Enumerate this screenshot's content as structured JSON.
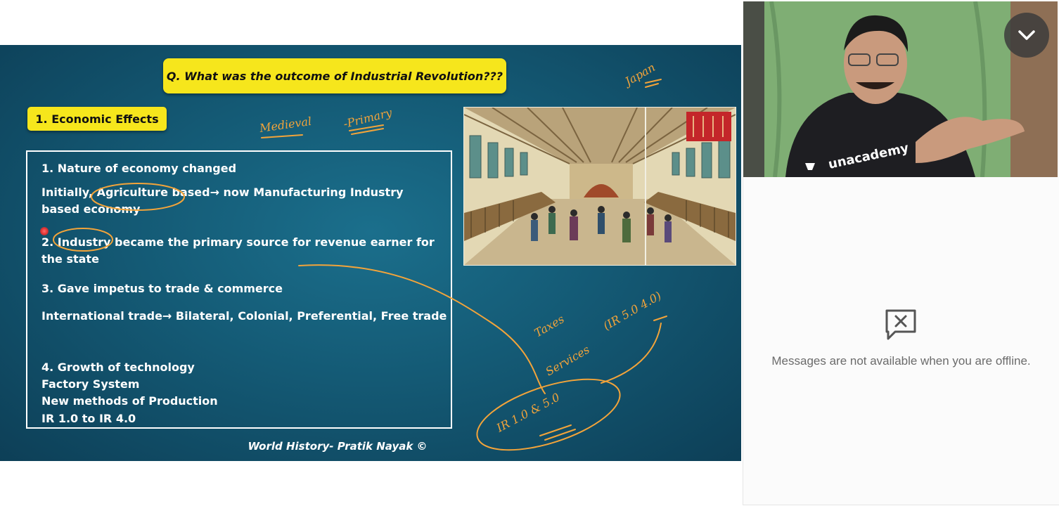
{
  "slide": {
    "question": "Q. What was the outcome of Industrial Revolution???",
    "section": "1. Economic Effects",
    "points": [
      "1. Nature of economy changed",
      "Initially, Agriculture based→ now Manufacturing Industry based economy",
      "2. Industry became the primary source for revenue earner for the state",
      "3. Gave impetus to trade & commerce",
      "International trade→ Bilateral, Colonial, Preferential, Free trade",
      "4. Growth of technology",
      "Factory System",
      "New methods of Production",
      "IR 1.0 to IR 4.0"
    ],
    "footer": "World History- Pratik Nayak ©",
    "image_alt": "Woodblock print of a textile factory interior",
    "annotations": {
      "medieval": "Medieval",
      "primary": "-Primary",
      "japan": "Japan",
      "taxes": "Taxes",
      "services": "Services",
      "ir_range": "IR 1.0 & 5.0",
      "ir_alt": "(IR 5.0 4.0)"
    }
  },
  "video": {
    "brand": "unacademy"
  },
  "chat": {
    "offline_message": "Messages are not available when you are offline."
  },
  "colors": {
    "slide_bg": "#145a75",
    "highlight": "#f6e61c",
    "ink": "#f3a43a",
    "chat_text": "#6b6b6b"
  },
  "icons": {
    "collapse": "chevron-down-icon",
    "offline": "message-blocked-icon"
  }
}
